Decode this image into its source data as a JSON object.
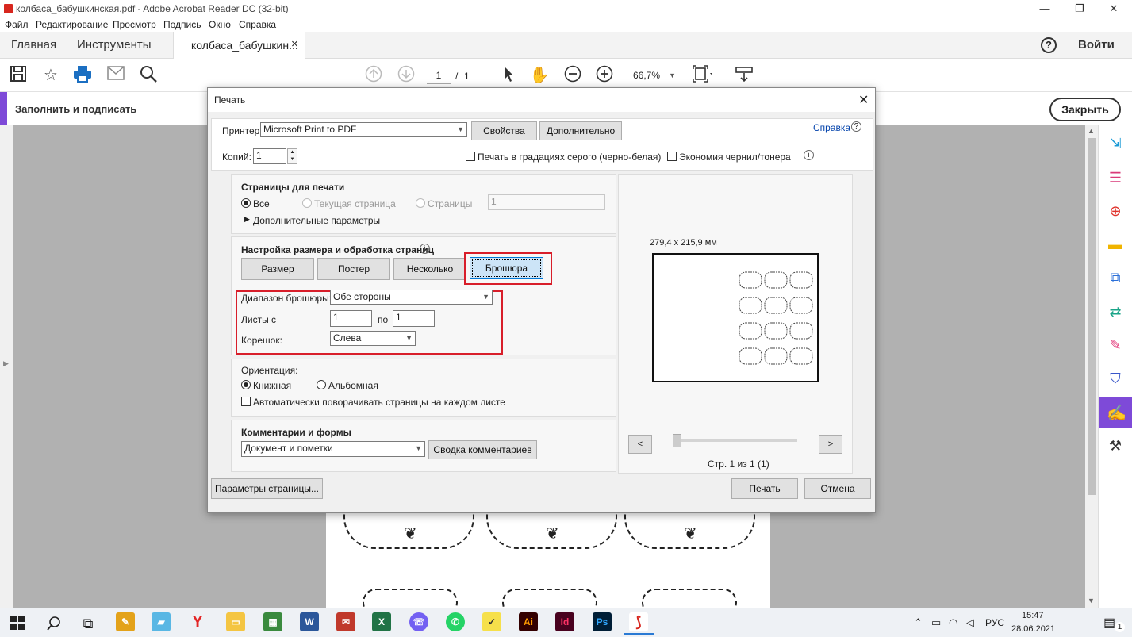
{
  "window": {
    "title": "колбаса_бабушкинская.pdf - Adobe Acrobat Reader DC (32-bit)"
  },
  "menu": [
    "Файл",
    "Редактирование",
    "Просмотр",
    "Подпись",
    "Окно",
    "Справка"
  ],
  "tabs": {
    "home": "Главная",
    "tools": "Инструменты",
    "doc": "колбаса_бабушкин...",
    "doc_close": "×",
    "help_icon": "?",
    "login": "Войти"
  },
  "toolbar": {
    "page_current": "1",
    "page_sep": "/",
    "page_total": "1",
    "zoom": "66,7%"
  },
  "fillsign": {
    "title": "Заполнить и подписать",
    "close": "Закрыть"
  },
  "dialog": {
    "title": "Печать",
    "printer_label": "Принтер:",
    "printer_value": "Microsoft Print to PDF",
    "properties": "Свойства",
    "advanced": "Дополнительно",
    "help": "Справка",
    "copies_label": "Копий:",
    "copies_value": "1",
    "grayscale": "Печать в градациях серого (черно-белая)",
    "save_ink": "Экономия чернил/тонера",
    "pages": {
      "heading": "Страницы для печати",
      "all": "Все",
      "current": "Текущая страница",
      "pages": "Страницы",
      "pages_value": "1",
      "more": "Дополнительные параметры"
    },
    "sizing": {
      "heading": "Настройка размера и обработка страниц",
      "size": "Размер",
      "poster": "Постер",
      "multiple": "Несколько",
      "booklet": "Брошюра"
    },
    "booklet": {
      "range_label": "Диапазон брошюры:",
      "range_value": "Обе стороны",
      "sheets_label": "Листы с",
      "sheets_from": "1",
      "to_label": "по",
      "sheets_to": "1",
      "binding_label": "Корешок:",
      "binding_value": "Слева"
    },
    "orientation": {
      "heading": "Ориентация:",
      "portrait": "Книжная",
      "landscape": "Альбомная",
      "auto_rotate": "Автоматически поворачивать страницы на каждом листе"
    },
    "comments": {
      "heading": "Комментарии и формы",
      "value": "Документ и пометки",
      "summary": "Сводка комментариев"
    },
    "preview": {
      "size": "279,4 x 215,9 мм",
      "prev": "<",
      "next": ">",
      "page_info": "Стр. 1 из 1 (1)"
    },
    "page_setup": "Параметры страницы...",
    "print": "Печать",
    "cancel": "Отмена"
  },
  "taskbar": {
    "lang": "РУС",
    "time": "15:47",
    "date": "28.06.2021",
    "notif": "1"
  },
  "colors": {
    "accent": "#7e4ad8",
    "highlight": "#d81e2a",
    "selected_button": "#cce4f7"
  }
}
